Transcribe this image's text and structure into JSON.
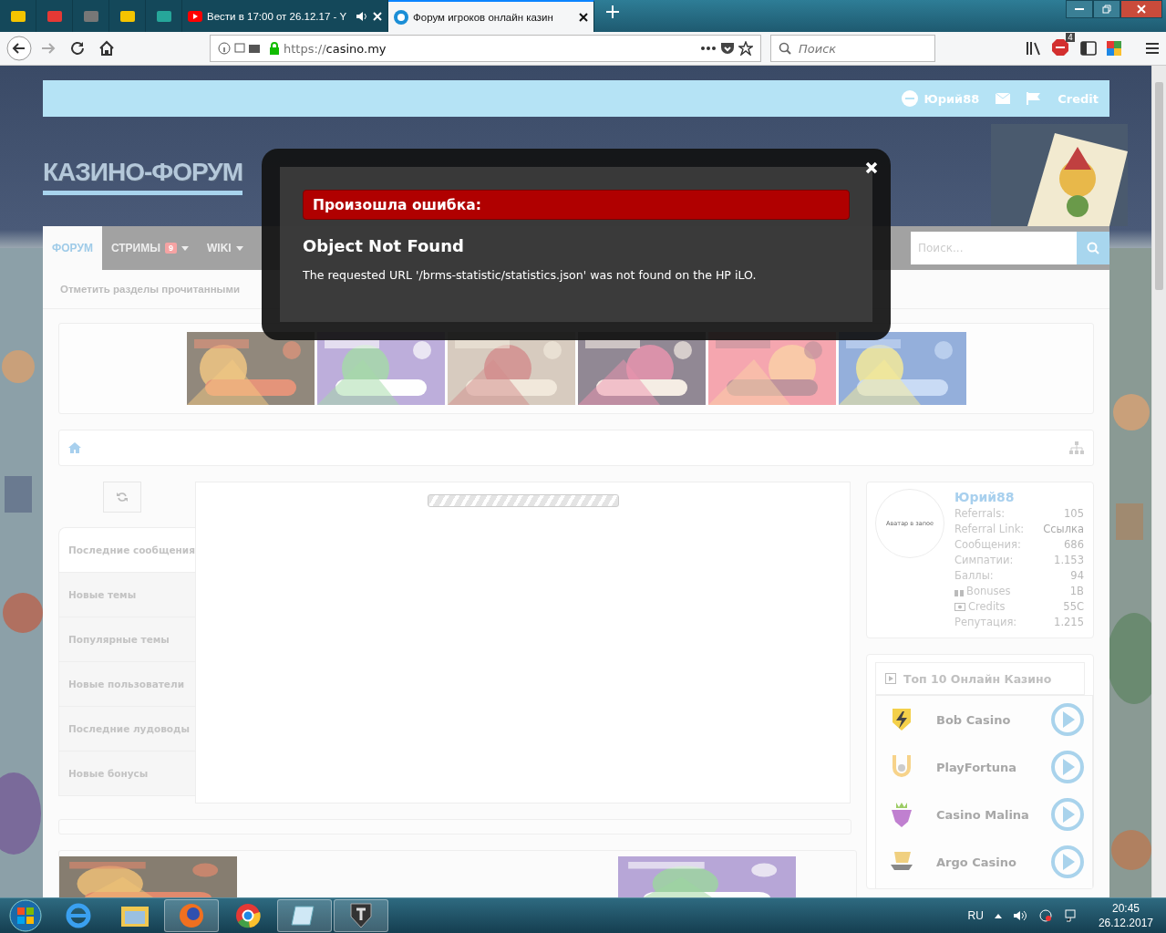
{
  "browser": {
    "tabs": [
      {
        "title": "Вести в 17:00 от 26.12.17 - Y",
        "selected": false,
        "audio": true
      },
      {
        "title": "Форум игроков онлайн казин",
        "selected": true,
        "audio": false
      }
    ],
    "url_scheme": "https://",
    "url_host": "casino.my",
    "search_placeholder": "Поиск",
    "addon_badge": "4"
  },
  "site": {
    "user": "Юрий88",
    "credit": "Credit",
    "logo": "КАЗИНО-ФОРУМ",
    "nav": [
      {
        "label": "ФОРУМ",
        "selected": true,
        "dropdown": false
      },
      {
        "label": "СТРИМЫ",
        "selected": false,
        "dropdown": true,
        "badge": "9"
      },
      {
        "label": "WIKI",
        "selected": false,
        "dropdown": true
      }
    ],
    "search_placeholder": "Поиск...",
    "subnav": [
      "Отметить разделы прочитанными"
    ],
    "banners": [
      {
        "kind": "picture"
      },
      {
        "kind": "picture"
      },
      {
        "kind": "picture"
      },
      {
        "kind": "picture"
      },
      {
        "kind": "picture"
      },
      {
        "kind": "picture"
      }
    ],
    "sidebar_tabs": [
      {
        "label": "Последние сообщения",
        "selected": true
      },
      {
        "label": "Новые темы",
        "selected": false
      },
      {
        "label": "Популярные темы",
        "selected": false
      },
      {
        "label": "Новые пользователи",
        "selected": false
      },
      {
        "label": "Последние лудоводы",
        "selected": false
      },
      {
        "label": "Новые бонусы",
        "selected": false
      }
    ],
    "loading": true,
    "profile": {
      "avatar_text": "Аватар в запое",
      "name": "Юрий88",
      "stats": [
        {
          "label": "Referrals:",
          "value": "105",
          "kind": "plain"
        },
        {
          "label": "Referral Link:",
          "value": "Ссылка",
          "kind": "link"
        },
        {
          "label": "Сообщения:",
          "value": "686",
          "kind": "plain"
        },
        {
          "label": "Симпатии:",
          "value": "1.153",
          "kind": "plain"
        },
        {
          "label": "Баллы:",
          "value": "94",
          "kind": "plain"
        },
        {
          "label": "Bonuses",
          "value": "1B",
          "kind": "gift"
        },
        {
          "label": "Credits",
          "value": "55C",
          "kind": "money"
        },
        {
          "label": "Репутация:",
          "value": "1.215",
          "kind": "plain"
        }
      ]
    },
    "top_casinos": {
      "title": "Топ 10 Онлайн Казино",
      "items": [
        {
          "name": "Bob Casino",
          "kind": "shield"
        },
        {
          "name": "PlayFortuna",
          "kind": "horseshoe"
        },
        {
          "name": "Casino Malina",
          "kind": "berry"
        },
        {
          "name": "Argo Casino",
          "kind": "ship"
        }
      ]
    },
    "screenshots": [
      {
        "kind": "picture"
      },
      {
        "kind": "picture"
      }
    ]
  },
  "modal": {
    "error_title": "Произошла ошибка:",
    "heading": "Object Not Found",
    "message": "The requested URL '/brms-statistic/statistics.json' was not found on the HP iLO."
  },
  "taskbar": {
    "apps": [
      {
        "kind": "ie",
        "selected": false
      },
      {
        "kind": "folder",
        "selected": false
      },
      {
        "kind": "firefox",
        "selected": true
      },
      {
        "kind": "chrome",
        "selected": false
      },
      {
        "kind": "notepad",
        "selected": true
      },
      {
        "kind": "tank",
        "selected": true
      }
    ],
    "language": "RU",
    "time": "20:45",
    "date": "26.12.2017"
  }
}
